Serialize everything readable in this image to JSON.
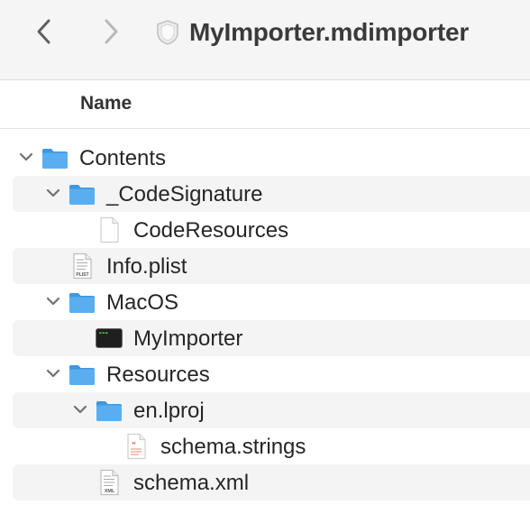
{
  "window": {
    "title": "MyImporter.mdimporter",
    "back_icon": "chevron-left-icon",
    "forward_icon": "chevron-right-icon",
    "title_icon": "shield-icon"
  },
  "header": {
    "name_column": "Name"
  },
  "tree": [
    {
      "label": "Contents",
      "level": 0,
      "expanded": true,
      "kind": "folder"
    },
    {
      "label": "_CodeSignature",
      "level": 1,
      "expanded": true,
      "kind": "folder"
    },
    {
      "label": "CodeResources",
      "level": 2,
      "expanded": null,
      "kind": "document"
    },
    {
      "label": "Info.plist",
      "level": 1,
      "expanded": null,
      "kind": "plist-file",
      "badge": "PLIST"
    },
    {
      "label": "MacOS",
      "level": 1,
      "expanded": true,
      "kind": "folder"
    },
    {
      "label": "MyImporter",
      "level": 2,
      "expanded": null,
      "kind": "executable"
    },
    {
      "label": "Resources",
      "level": 1,
      "expanded": true,
      "kind": "folder"
    },
    {
      "label": "en.lproj",
      "level": 2,
      "expanded": true,
      "kind": "folder"
    },
    {
      "label": "schema.strings",
      "level": 3,
      "expanded": null,
      "kind": "strings-file"
    },
    {
      "label": "schema.xml",
      "level": 2,
      "expanded": null,
      "kind": "xml-file",
      "badge": "XML"
    }
  ],
  "colors": {
    "folder": "#5aaef0",
    "folder_dark": "#3e97df",
    "toolbar_bg": "#f5f5f5",
    "alt_row": "#f4f4f4"
  }
}
